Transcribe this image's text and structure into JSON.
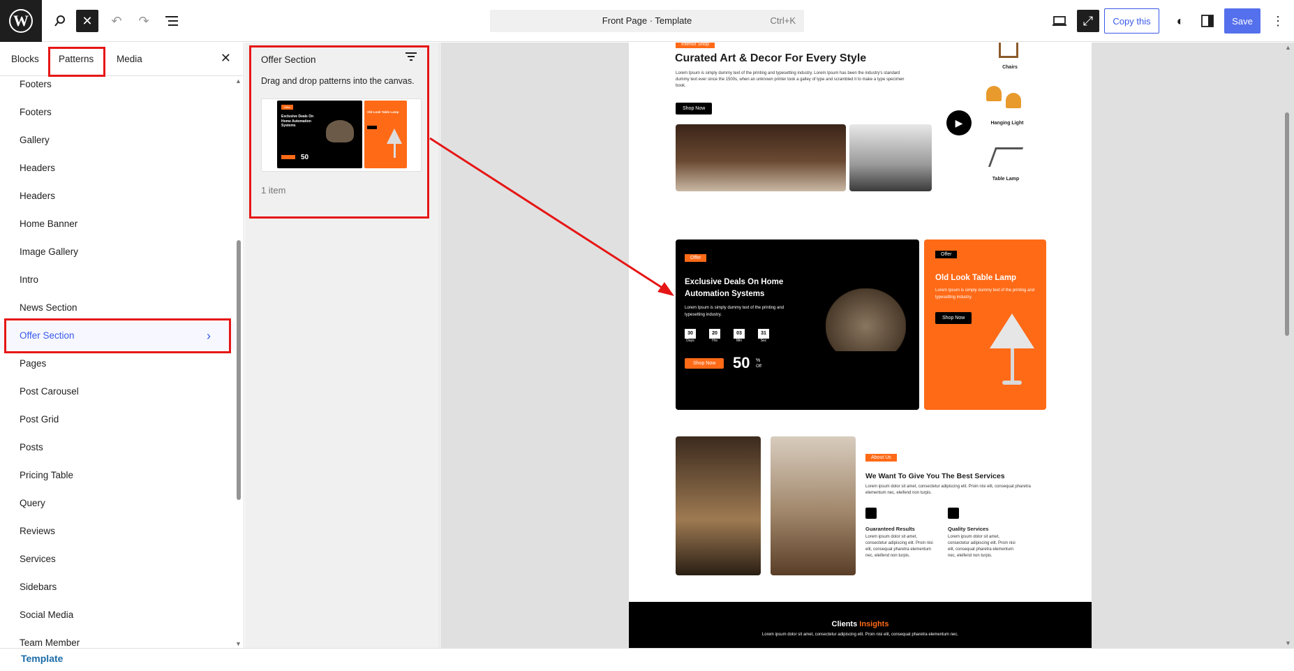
{
  "topbar": {
    "logo": "W",
    "command_title": "Front Page · Template",
    "command_shortcut": "Ctrl+K",
    "copy_label": "Copy this",
    "save_label": "Save"
  },
  "sidebar": {
    "tabs": [
      "Blocks",
      "Patterns",
      "Media"
    ],
    "categories": [
      "Footers",
      "Footers",
      "Gallery",
      "Headers",
      "Headers",
      "Home Banner",
      "Image Gallery",
      "Intro",
      "News Section",
      "Offer Section",
      "Pages",
      "Post Carousel",
      "Post Grid",
      "Posts",
      "Pricing Table",
      "Query",
      "Reviews",
      "Services",
      "Sidebars",
      "Social Media",
      "Team Member"
    ],
    "selected": "Offer Section"
  },
  "patterns_panel": {
    "title": "Offer Section",
    "hint": "Drag and drop patterns into the canvas.",
    "count": "1 item",
    "thumb": {
      "offer": "Offer",
      "title": "Exclusive Deals On Home Automation Systems",
      "lamp": "Old Look Table Lamp",
      "pct": "50"
    }
  },
  "canvas": {
    "hero": {
      "badge": "Interior Shop",
      "title": "Curated Art & Decor For Every Style",
      "text": "Lorem Ipsum is simply dummy text of the printing and typesetting industry. Lorem Ipsum has been the industry's standard dummy text ever since the 1500s, when an unknown printer took a galley of type and scrambled it to make a type specimen book.",
      "button": "Shop Now",
      "products": [
        "Chairs",
        "Hanging Light",
        "Table Lamp"
      ]
    },
    "offer": {
      "badge": "Offer",
      "title": "Exclusive Deals On Home Automation Systems",
      "text": "Lorem Ipsum is simply dummy text of the printing and typesetting industry.",
      "countdown": [
        {
          "value": "30",
          "unit": "Days"
        },
        {
          "value": "20",
          "unit": "Hrs"
        },
        {
          "value": "03",
          "unit": "Min"
        },
        {
          "value": "31",
          "unit": "Sec"
        }
      ],
      "button": "Shop Now",
      "discount": "50",
      "discount_pct": "%",
      "discount_off": "Off"
    },
    "lamp": {
      "badge": "Offer",
      "title": "Old Look Table Lamp",
      "text": "Lorem Ipsum is simply dummy text of the printing and typesetting industry.",
      "button": "Shop Now"
    },
    "about": {
      "badge": "About Us",
      "title": "We Want To Give You The Best Services",
      "text": "Lorem ipsum dolor sit amet, consectetur adipiscing elit. Proin nisi elit, consequat pharetra elementum nec, eleifend non turpis.",
      "features": [
        {
          "title": "Guaranteed Results",
          "text": "Lorem ipsum dolor sit amet, consectetur adipiscing elit. Proin nisi elit, consequat pharetra elementum nec, eleifend non turpis."
        },
        {
          "title": "Quality Services",
          "text": "Lorem ipsum dolor sit amet, consectetur adipiscing elit. Proin nisi elit, consequat pharetra elementum nec, eleifend non turpis."
        }
      ]
    },
    "clients": {
      "title_a": "Clients",
      "title_b": "Insights",
      "text": "Lorem ipsum dolor sit amet, consectetur adipiscing elit. Proin nisi elit, consequat pharetra elementum nec."
    }
  },
  "footer": {
    "breadcrumb": "Template"
  },
  "colors": {
    "accent": "#3858e9",
    "highlight": "#e61616",
    "orange": "#ff6a17"
  }
}
